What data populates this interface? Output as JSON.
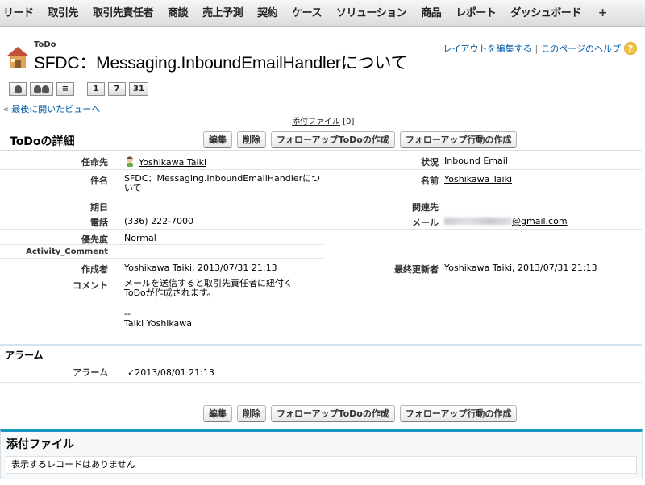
{
  "nav": {
    "items": [
      "リード",
      "取引先",
      "取引先責任者",
      "商談",
      "売上予測",
      "契約",
      "ケース",
      "ソリューション",
      "商品",
      "レポート",
      "ダッシュボード"
    ],
    "plus": "+"
  },
  "header": {
    "object_label": "ToDo",
    "title": "SFDC：Messaging.InboundEmailHandlerについて",
    "edit_layout_link": "レイアウトを編集する",
    "separator": "|",
    "help_link": "このページのヘルプ",
    "help_icon_glyph": "?"
  },
  "mini_toolbar": {
    "buttons": [
      "1",
      "7",
      "31"
    ]
  },
  "back_link": {
    "arrow": "«",
    "label": "最後に開いたビューへ"
  },
  "attachments_link": {
    "label": "添付ファイル",
    "count": "[0]"
  },
  "detail": {
    "title": "ToDoの詳細",
    "buttons": {
      "edit": "編集",
      "delete": "削除",
      "followup_todo": "フォローアップToDoの作成",
      "followup_event": "フォローアップ行動の作成"
    },
    "fields": {
      "assigned_to_label": "任命先",
      "assigned_to_value": "Yoshikawa Taiki",
      "status_label": "状況",
      "status_value": "Inbound Email",
      "subject_label": "件名",
      "subject_value": "SFDC：Messaging.InboundEmailHandlerについて",
      "name_label": "名前",
      "name_value": "Yoshikawa Taiki",
      "due_date_label": "期日",
      "related_to_label": "関連先",
      "phone_label": "電話",
      "phone_value": "(336) 222-7000",
      "email_label": "メール",
      "email_value_suffix": "@gmail.com",
      "priority_label": "優先度",
      "priority_value": "Normal",
      "activity_comment_label": "Activity_Comment",
      "created_by_label": "作成者",
      "created_by_value": "Yoshikawa Taiki",
      "created_by_date": ", 2013/07/31 21:13",
      "last_modified_label": "最終更新者",
      "last_modified_value": "Yoshikawa Taiki",
      "last_modified_date": ", 2013/07/31 21:13",
      "comment_label": "コメント",
      "comment_line1": "メールを送信すると取引先責任者に紐付く",
      "comment_line2": "ToDoが作成されます。",
      "comment_line3": "--",
      "comment_line4": "Taiki Yoshikawa"
    }
  },
  "alarm": {
    "section_title": "アラーム",
    "label": "アラーム",
    "check": "✓",
    "value": "2013/08/01 21:13"
  },
  "attachments": {
    "title": "添付ファイル",
    "empty_text": "表示するレコードはありません"
  }
}
